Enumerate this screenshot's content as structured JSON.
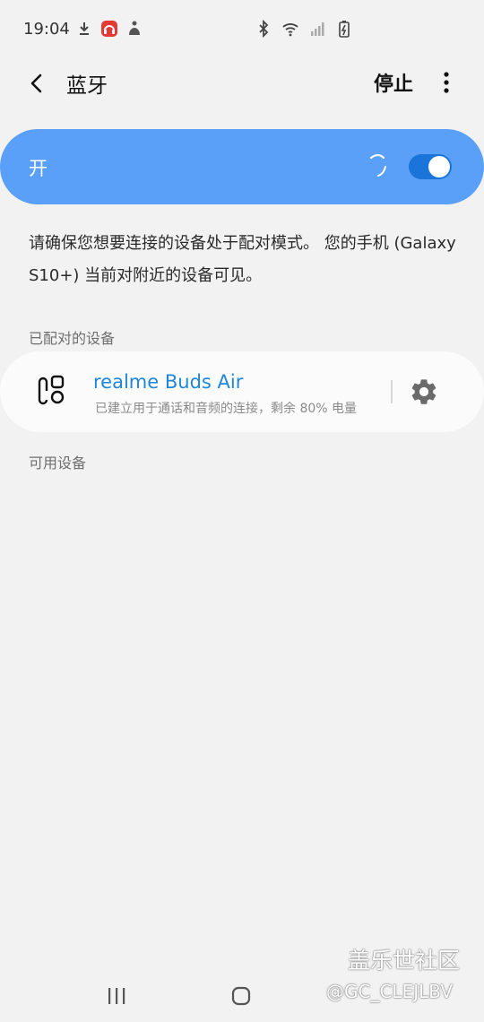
{
  "status_bar": {
    "time": "19:04",
    "left_icons": [
      "download-icon",
      "headset-app-icon",
      "accessibility-icon"
    ],
    "right_icons": [
      "bluetooth-icon",
      "wifi-icon",
      "signal-icon",
      "battery-charging-icon"
    ]
  },
  "app_bar": {
    "title": "蓝牙",
    "action_label": "停止"
  },
  "master_switch": {
    "label": "开",
    "on": true
  },
  "description": "请确保您想要连接的设备处于配对模式。 您的手机 (Galaxy S10+) 当前对附近的设备可见。",
  "paired_section": {
    "label": "已配对的设备",
    "devices": [
      {
        "name": "realme Buds Air",
        "status": "已建立用于通话和音频的连接，剩余 80% 电量",
        "icon": "earbuds-icon"
      }
    ]
  },
  "available_section": {
    "label": "可用设备"
  },
  "watermark": {
    "title": "盖乐世社区",
    "user": "@GC_CLEJLBV"
  },
  "colors": {
    "accent": "#1f86d9",
    "switch_bar": "#5aa0f8",
    "toggle": "#1a74d9",
    "background": "#f2f2f2"
  }
}
